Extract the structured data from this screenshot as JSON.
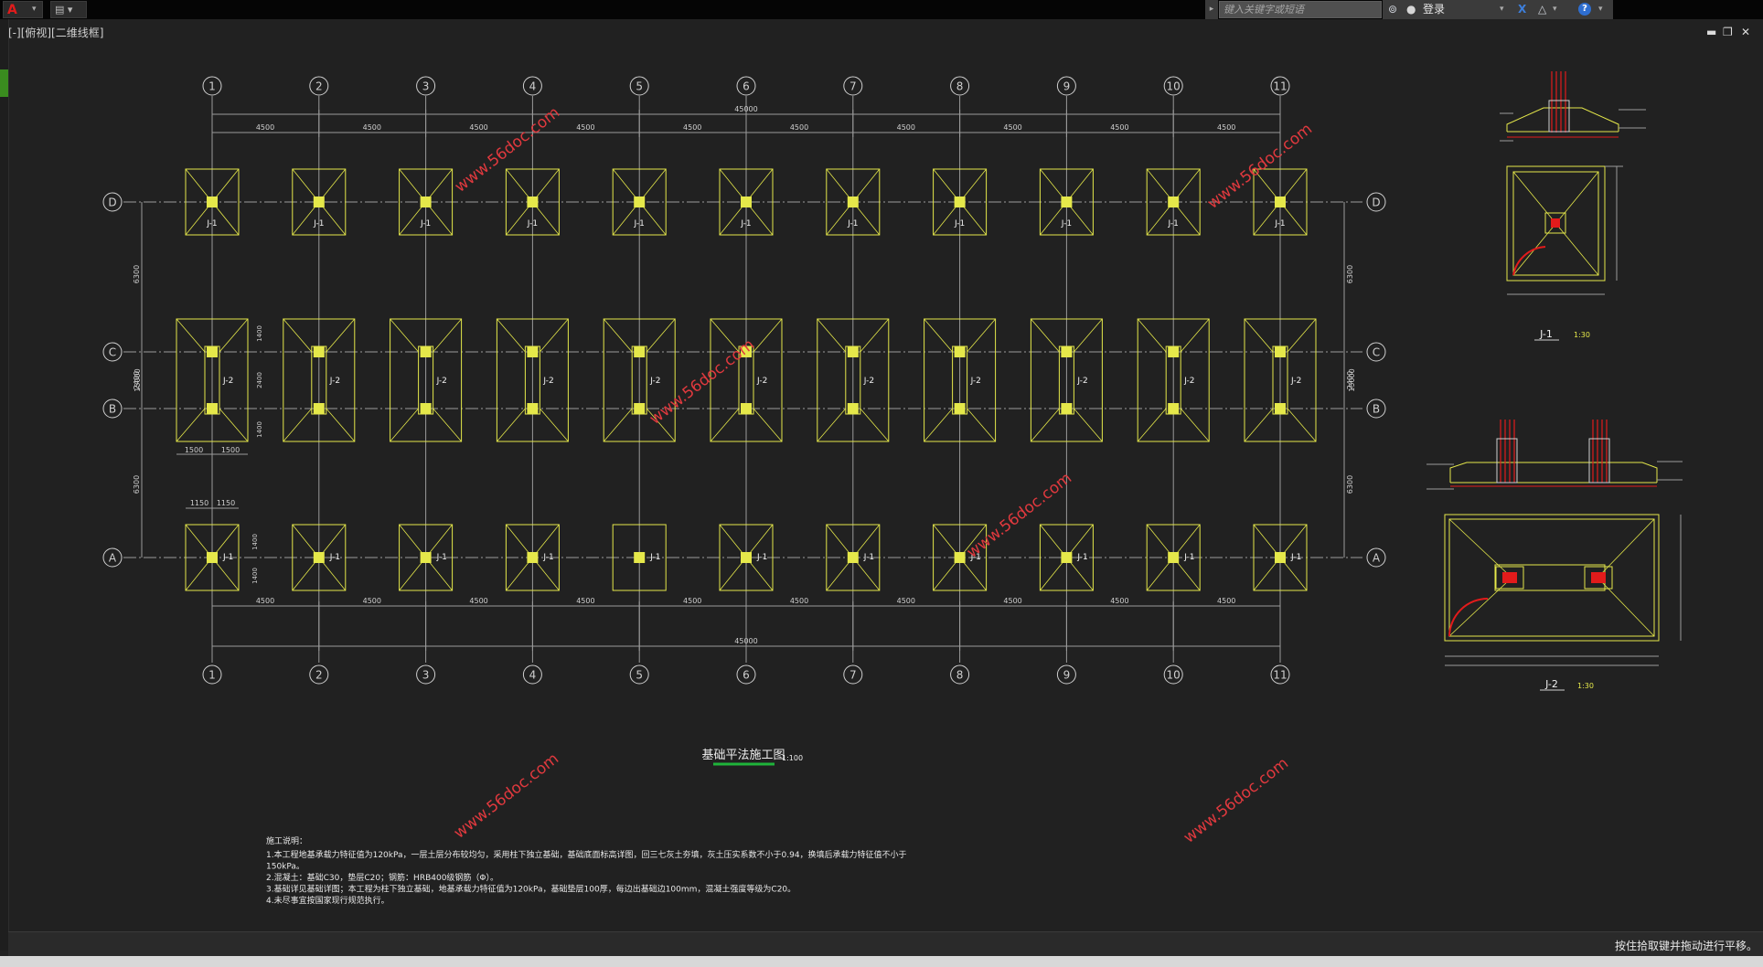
{
  "app": {
    "logo_letter": "A",
    "quick_access_label": "▤ ▾"
  },
  "search": {
    "placeholder": "键入关键字或短语"
  },
  "toolbar": {
    "login_label": "登录",
    "help_label": "?"
  },
  "viewport_label": "[-][俯视][二维线框]",
  "drawing": {
    "title": "基础平法施工图",
    "title_scale": "1:100",
    "col_labels": [
      "1",
      "2",
      "3",
      "4",
      "5",
      "6",
      "7",
      "8",
      "9",
      "10",
      "11"
    ],
    "row_labels": [
      "D",
      "C",
      "B",
      "A"
    ],
    "bay_dim": "4500",
    "total_dim": "45000",
    "overall_vertical_dim": "15000",
    "span_dim_ab": "6300",
    "span_dim_bc": "2400",
    "span_dim_cd": "6300",
    "j2_half_dim": "1500",
    "j2_edge_dim": "1400",
    "j1_half_dim": "1150",
    "footing_j1": "J-1",
    "footing_j2": "J-2",
    "detail_j1_label": "J-1",
    "detail_j1_scale": "1:30",
    "detail_j2_label": "J-2",
    "detail_j2_scale": "1:30",
    "watermark": "www.56doc.com",
    "notes_title": "施工说明：",
    "notes": [
      "1.本工程地基承载力特征值为120kPa，一层土层分布较均匀，采用柱下独立基础，基础底面标高详图，回三七灰土夯填，灰土压实系数不小于0.94，换填后承载力特征值不小于",
      "150kPa。",
      "2.混凝土：基础C30，垫层C20；钢筋：HRB400级钢筋（Φ）。",
      "3.基础详见基础详图；本工程为柱下独立基础，地基承载力特征值为120kPa，基础垫层100厚，每边出基础边100mm，混凝土强度等级为C20。",
      "4.未尽事宜按国家现行规范执行。"
    ]
  },
  "status": {
    "hint": "按住拾取键并拖动进行平移。"
  },
  "colors": {
    "background": "#212121",
    "footing": "#e5e84a",
    "grid": "#cfcfcf",
    "watermark": "#e0393e",
    "rebar": "#e21b1b",
    "title_underline": "#1fb43a"
  }
}
